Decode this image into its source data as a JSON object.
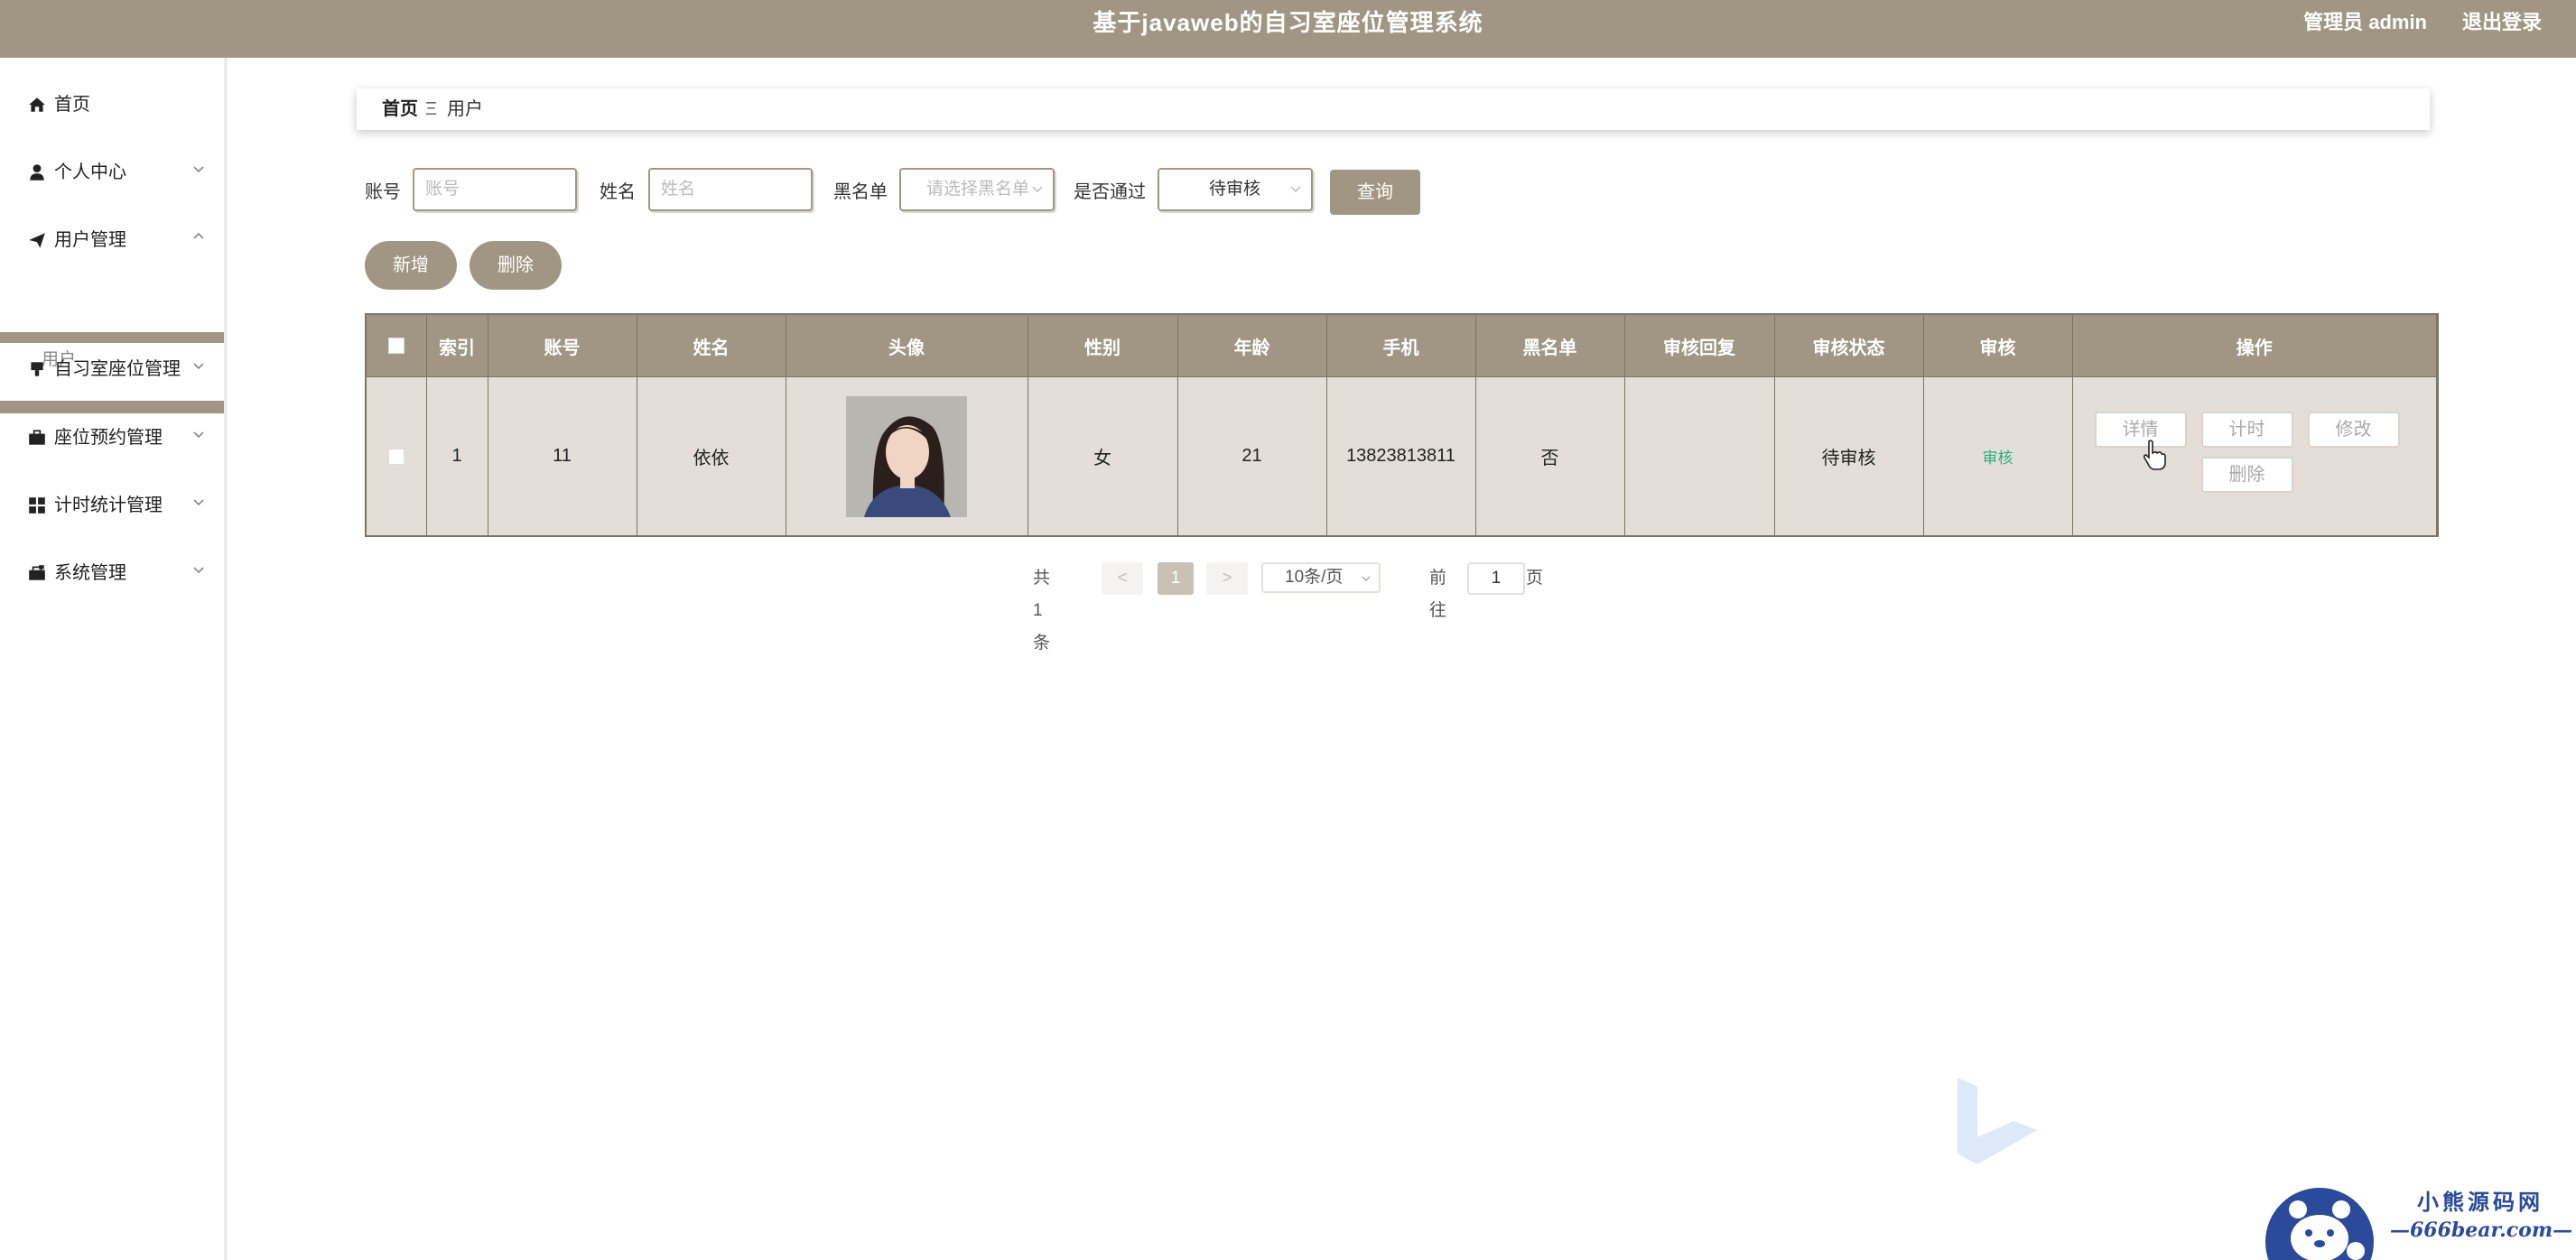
{
  "header": {
    "title": "基于javaweb的自习室座位管理系统",
    "user": "管理员 admin",
    "logout": "退出登录"
  },
  "sidebar": {
    "items": [
      {
        "label": "首页",
        "icon": "home-icon"
      },
      {
        "label": "个人中心",
        "icon": "user-icon"
      },
      {
        "label": "用户管理",
        "icon": "paper-plane-icon"
      },
      {
        "label": "自习室座位管理",
        "icon": "seat-icon"
      },
      {
        "label": "座位预约管理",
        "icon": "briefcase-icon"
      },
      {
        "label": "计时统计管理",
        "icon": "grid-icon"
      },
      {
        "label": "系统管理",
        "icon": "toolbox-icon"
      }
    ],
    "submenu": {
      "label": "用户"
    }
  },
  "breadcrumb": {
    "home": "首页",
    "sep": "Ξ",
    "current": "用户"
  },
  "search": {
    "account_label": "账号",
    "account_placeholder": "账号",
    "name_label": "姓名",
    "name_placeholder": "姓名",
    "blacklist_label": "黑名单",
    "blacklist_placeholder": "请选择黑名单",
    "passed_label": "是否通过",
    "passed_value": "待审核",
    "query_button": "查询"
  },
  "actions": {
    "add": "新增",
    "delete": "删除"
  },
  "table": {
    "headers": [
      "索引",
      "账号",
      "姓名",
      "头像",
      "性别",
      "年龄",
      "手机",
      "黑名单",
      "审核回复",
      "审核状态",
      "审核",
      "操作"
    ],
    "rows": [
      {
        "index": "1",
        "account": "11",
        "name": "依依",
        "gender": "女",
        "age": "21",
        "phone": "13823813811",
        "blacklist": "否",
        "reply": "",
        "status": "待审核",
        "audit": "审核",
        "ops": {
          "detail": "详情",
          "timer": "计时",
          "edit": "修改",
          "delete": "删除"
        }
      }
    ]
  },
  "pagination": {
    "total": "共 1 条",
    "prev": "<",
    "page": "1",
    "next": ">",
    "page_size": "10条/页",
    "goto_label": "前往",
    "goto_value": "1",
    "goto_suffix": "页"
  },
  "watermark": {
    "brand_name": "小熊源码网",
    "brand_url": "—666bear.com—"
  },
  "colors": {
    "accent": "#a09683",
    "row_bg": "#e3dfd8",
    "audit_link": "#2bb07e"
  }
}
